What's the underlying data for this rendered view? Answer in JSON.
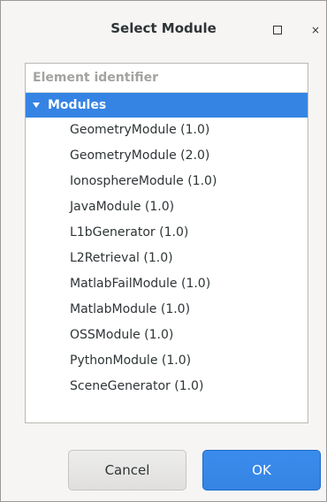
{
  "window": {
    "title": "Select Module",
    "maximize_icon": "maximize-icon",
    "close_glyph": "×"
  },
  "tree": {
    "column_header": "Element identifier",
    "root": {
      "label": "Modules",
      "expanded": true,
      "selected": true
    },
    "items": [
      {
        "label": "GeometryModule (1.0)"
      },
      {
        "label": "GeometryModule (2.0)"
      },
      {
        "label": "IonosphereModule (1.0)"
      },
      {
        "label": "JavaModule (1.0)"
      },
      {
        "label": "L1bGenerator (1.0)"
      },
      {
        "label": "L2Retrieval (1.0)"
      },
      {
        "label": "MatlabFailModule (1.0)"
      },
      {
        "label": "MatlabModule (1.0)"
      },
      {
        "label": "OSSModule (1.0)"
      },
      {
        "label": "PythonModule (1.0)"
      },
      {
        "label": "SceneGenerator (1.0)"
      }
    ]
  },
  "buttons": {
    "cancel_label": "Cancel",
    "ok_label": "OK"
  },
  "colors": {
    "accent": "#3584e4",
    "text": "#2e3436",
    "header_text": "#a3a3a0"
  }
}
